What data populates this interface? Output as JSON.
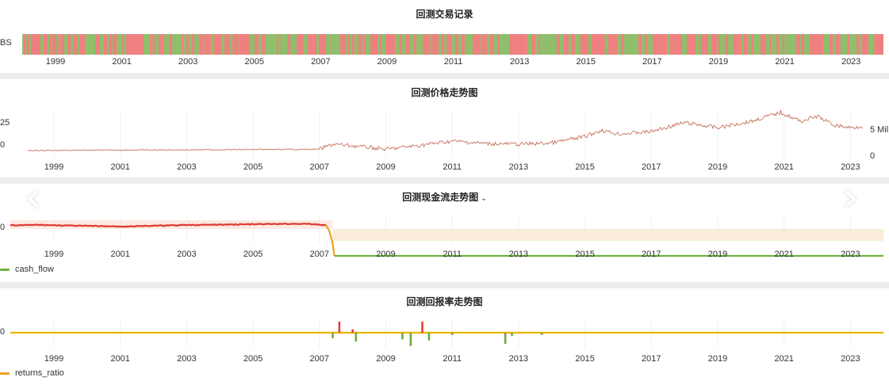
{
  "panels": {
    "trades": {
      "title": "回测交易记录",
      "row_label": "BS"
    },
    "price": {
      "title": "回测价格走势图",
      "y_left_ticks": [
        "25",
        "0"
      ],
      "y_right_ticks": [
        "5 Mil",
        "0"
      ]
    },
    "cash": {
      "title": "回测现金流走势图",
      "dropdown_icon": "chevron-down-icon",
      "y_tick": "0",
      "legend": "cash_flow"
    },
    "returns": {
      "title": "回测回报率走势图",
      "y_tick": "0",
      "legend": "returns_ratio"
    }
  },
  "nav": {
    "prev_icon": "chevron-left-icon",
    "next_icon": "chevron-right-icon"
  },
  "colors": {
    "buy": "#8fbf6b",
    "sell": "#ee8080",
    "price_line": "#c0614a",
    "cash_high": "#e03a2f",
    "cash_low": "#6ab43e",
    "cash_fill": "#f7e9cf",
    "returns_line": "#f0b400",
    "returns_pos": "#e63c2e",
    "returns_neg": "#6aa83a",
    "legend_cash": "#6ab43e",
    "legend_returns": "#f0a020"
  },
  "chart_data": [
    {
      "type": "heatmap",
      "title": "回测交易记录",
      "categories": [
        "BS"
      ],
      "x_ticks": [
        "1999",
        "2001",
        "2003",
        "2005",
        "2007",
        "2009",
        "2011",
        "2013",
        "2015",
        "2017",
        "2019",
        "2021",
        "2023"
      ]
    },
    {
      "type": "line",
      "title": "回测价格走势图",
      "x_ticks": [
        "1999",
        "2001",
        "2003",
        "2005",
        "2007",
        "2009",
        "2011",
        "2013",
        "2015",
        "2017",
        "2019",
        "2021",
        "2023"
      ],
      "x_range": [
        1997.8,
        2023.6
      ],
      "y_right_ticks": [
        "5 Mil",
        "0"
      ],
      "series": [
        {
          "values": [
            [
              1997.9,
              0.0
            ],
            [
              2007.0,
              0.1
            ],
            [
              2007.4,
              0.5
            ],
            [
              2008.3,
              0.3
            ],
            [
              2009.0,
              0.1
            ],
            [
              2010.0,
              0.4
            ],
            [
              2011.0,
              0.75
            ],
            [
              2012.0,
              0.55
            ],
            [
              2013.0,
              0.5
            ],
            [
              2014.0,
              0.6
            ],
            [
              2015.0,
              1.1
            ],
            [
              2015.5,
              1.6
            ],
            [
              2016.0,
              1.3
            ],
            [
              2017.0,
              1.5
            ],
            [
              2018.0,
              2.2
            ],
            [
              2019.0,
              1.8
            ],
            [
              2020.0,
              2.3
            ],
            [
              2020.9,
              3.0
            ],
            [
              2021.5,
              2.3
            ],
            [
              2022.0,
              2.7
            ],
            [
              2022.5,
              2.0
            ],
            [
              2023.0,
              1.8
            ],
            [
              2023.6,
              2.0
            ]
          ]
        }
      ]
    },
    {
      "type": "area",
      "title": "回测现金流走势图",
      "x_ticks": [
        "1999",
        "2001",
        "2003",
        "2005",
        "2007",
        "2009",
        "2011",
        "2013",
        "2015",
        "2017",
        "2019",
        "2021",
        "2023"
      ],
      "x_range": [
        1997.8,
        2023.6
      ],
      "series": [
        {
          "name": "cash_flow",
          "values": [
            [
              1997.8,
              10.0
            ],
            [
              1998.5,
              10.2
            ],
            [
              1999.5,
              9.9
            ],
            [
              2001.0,
              9.6
            ],
            [
              2003.0,
              10.1
            ],
            [
              2005.0,
              10.4
            ],
            [
              2006.5,
              10.6
            ],
            [
              2007.2,
              10.1
            ],
            [
              2007.4,
              -1.0
            ],
            [
              2023.6,
              -1.0
            ]
          ]
        }
      ]
    },
    {
      "type": "line",
      "title": "回测回报率走势图",
      "x_ticks": [
        "1999",
        "2001",
        "2003",
        "2005",
        "2007",
        "2009",
        "2011",
        "2013",
        "2015",
        "2017",
        "2019",
        "2021",
        "2023"
      ],
      "x_range": [
        1997.8,
        2023.6
      ],
      "series": [
        {
          "name": "returns_ratio",
          "spikes": [
            [
              2007.4,
              -0.5
            ],
            [
              2007.6,
              1.0
            ],
            [
              2008.0,
              0.3
            ],
            [
              2008.1,
              -0.8
            ],
            [
              2009.5,
              -0.6
            ],
            [
              2009.75,
              -1.2
            ],
            [
              2010.1,
              1.0
            ],
            [
              2010.3,
              -0.7
            ],
            [
              2011.0,
              -0.2
            ],
            [
              2012.6,
              -1.0
            ],
            [
              2012.8,
              -0.3
            ],
            [
              2013.7,
              -0.2
            ]
          ]
        }
      ]
    }
  ]
}
